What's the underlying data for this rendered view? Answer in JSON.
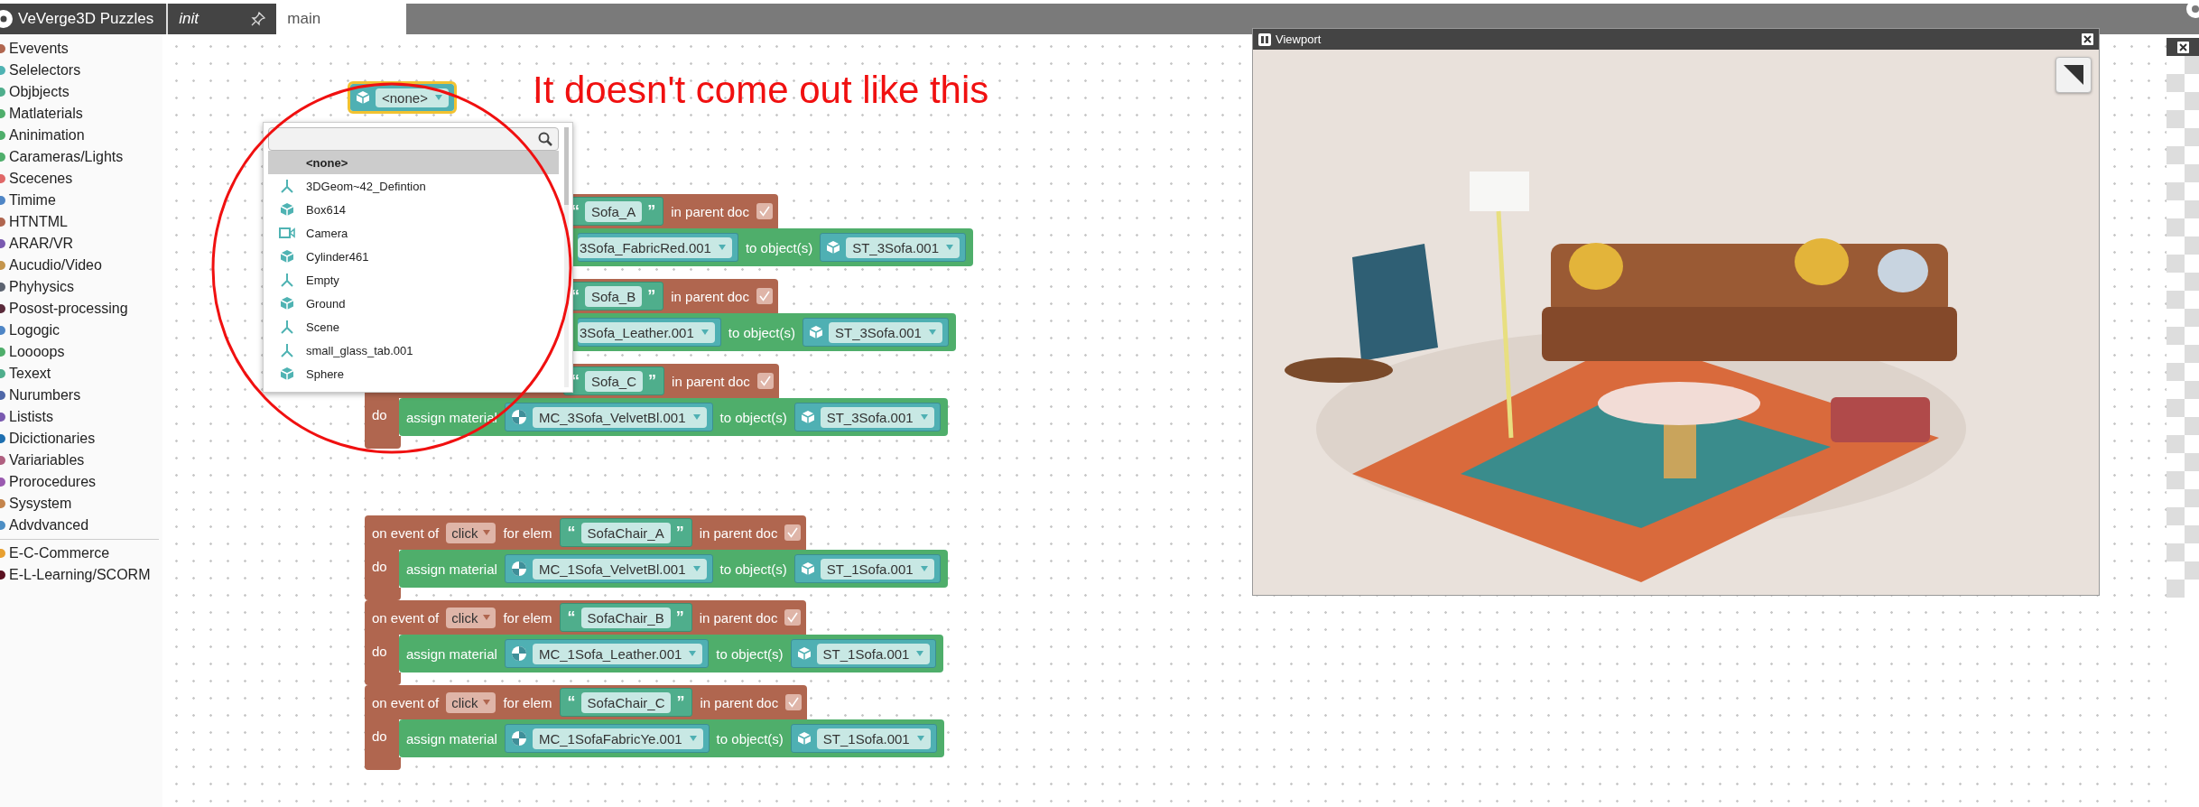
{
  "header": {
    "logo_text": "VeVerge3D Puzzles",
    "tabs": [
      {
        "label": "init",
        "selected": false,
        "pinned": true
      },
      {
        "label": "main",
        "selected": true,
        "pinned": false
      }
    ]
  },
  "sidebar": {
    "groups": [
      {
        "items": [
          {
            "label": "Evevents",
            "color": "#b0664f"
          },
          {
            "label": "Selelectors",
            "color": "#4fb3b3"
          },
          {
            "label": "Objbjects",
            "color": "#4fae8c"
          },
          {
            "label": "Matlaterials",
            "color": "#4fae6b"
          },
          {
            "label": "Aninimation",
            "color": "#4fae6b"
          },
          {
            "label": "Carameras/Lights",
            "color": "#4fae6b"
          },
          {
            "label": "Scecenes",
            "color": "#e06868"
          },
          {
            "label": "Timime",
            "color": "#4f86c6"
          },
          {
            "label": "HTNTML",
            "color": "#b0664f"
          },
          {
            "label": "ARAR/VR",
            "color": "#7a5ab0"
          },
          {
            "label": "Aucudio/Video",
            "color": "#c4954c"
          },
          {
            "label": "Phyhysics",
            "color": "#5c6370"
          },
          {
            "label": "Posost-processing",
            "color": "#5a2a3a"
          },
          {
            "label": "Logogic",
            "color": "#4f86c6"
          },
          {
            "label": "Loooops",
            "color": "#4fae6b"
          },
          {
            "label": "Texext",
            "color": "#4fae8c"
          },
          {
            "label": "Nurumbers",
            "color": "#4f67a8"
          },
          {
            "label": "Listists",
            "color": "#7a5ab0"
          },
          {
            "label": "Dicictionaries",
            "color": "#1e6fb0"
          },
          {
            "label": "Variariables",
            "color": "#b06080"
          },
          {
            "label": "Prorocedures",
            "color": "#9a5ab0"
          },
          {
            "label": "Sysystem",
            "color": "#c4844c"
          },
          {
            "label": "Advdvanced",
            "color": "#4c8ec4"
          }
        ]
      },
      {
        "items": [
          {
            "label": "E-C-Commerce",
            "color": "#e8a030"
          },
          {
            "label": "E-L-Learning/SCORM",
            "color": "#5a1020"
          }
        ]
      }
    ]
  },
  "object_block": {
    "value": "<none>",
    "selected": true
  },
  "dropdown": {
    "items": [
      {
        "label": "<none>",
        "kind": "none",
        "selected": true
      },
      {
        "label": "3DGeom~42_Defintion",
        "kind": "empty",
        "selected": false
      },
      {
        "label": "Box614",
        "kind": "mesh",
        "selected": false
      },
      {
        "label": "Camera",
        "kind": "camera",
        "selected": false
      },
      {
        "label": "Cylinder461",
        "kind": "mesh",
        "selected": false
      },
      {
        "label": "Empty",
        "kind": "empty",
        "selected": false
      },
      {
        "label": "Ground",
        "kind": "mesh",
        "selected": false
      },
      {
        "label": "Scene",
        "kind": "empty",
        "selected": false
      },
      {
        "label": "small_glass_tab.001",
        "kind": "empty",
        "selected": false
      },
      {
        "label": "Sphere",
        "kind": "mesh",
        "selected": false
      }
    ]
  },
  "block_stacks": [
    {
      "blocks": [
        {
          "quote_open": "“",
          "element": "Sofa_A",
          "quote_close": "”",
          "parent_label": "in parent doc",
          "in_parent_doc": true,
          "material": "3Sofa_FabricRed.001",
          "target_label": "to object(s)",
          "object": "ST_3Sofa.001"
        },
        {
          "quote_open": "“",
          "element": "Sofa_B",
          "quote_close": "”",
          "parent_label": "in parent doc",
          "in_parent_doc": true,
          "material": "3Sofa_Leather.001",
          "target_label": "to object(s)",
          "object": "ST_3Sofa.001"
        },
        {
          "quote_open": "“",
          "element": "Sofa_C",
          "quote_close": "”",
          "parent_label": "in parent doc",
          "in_parent_doc": true,
          "do_label": "do",
          "action_label": "assign material",
          "material": "MC_3Sofa_VelvetBl.001",
          "target_label": "to object(s)",
          "object": "ST_3Sofa.001"
        }
      ]
    },
    {
      "blocks": [
        {
          "event_label": "on event of",
          "event": "click",
          "elem_label": "for elem",
          "quote_open": "“",
          "element": "SofaChair_A",
          "quote_close": "”",
          "parent_label": "in parent doc",
          "in_parent_doc": true,
          "do_label": "do",
          "action_label": "assign material",
          "material": "MC_1Sofa_VelvetBl.001",
          "target_label": "to object(s)",
          "object": "ST_1Sofa.001"
        },
        {
          "event_label": "on event of",
          "event": "click",
          "elem_label": "for elem",
          "quote_open": "“",
          "element": "SofaChair_B",
          "quote_close": "”",
          "parent_label": "in parent doc",
          "in_parent_doc": true,
          "do_label": "do",
          "action_label": "assign material",
          "material": "MC_1Sofa_Leather.001",
          "target_label": "to object(s)",
          "object": "ST_1Sofa.001"
        },
        {
          "event_label": "on event of",
          "event": "click",
          "elem_label": "for elem",
          "quote_open": "“",
          "element": "SofaChair_C",
          "quote_close": "”",
          "parent_label": "in parent doc",
          "in_parent_doc": true,
          "do_label": "do",
          "action_label": "assign material",
          "material": "MC_1SofaFabricYe.001",
          "target_label": "to object(s)",
          "object": "ST_1Sofa.001"
        }
      ]
    }
  ],
  "annotation": {
    "text": "It doesn't come out like this"
  },
  "viewport": {
    "title": "Viewport"
  }
}
